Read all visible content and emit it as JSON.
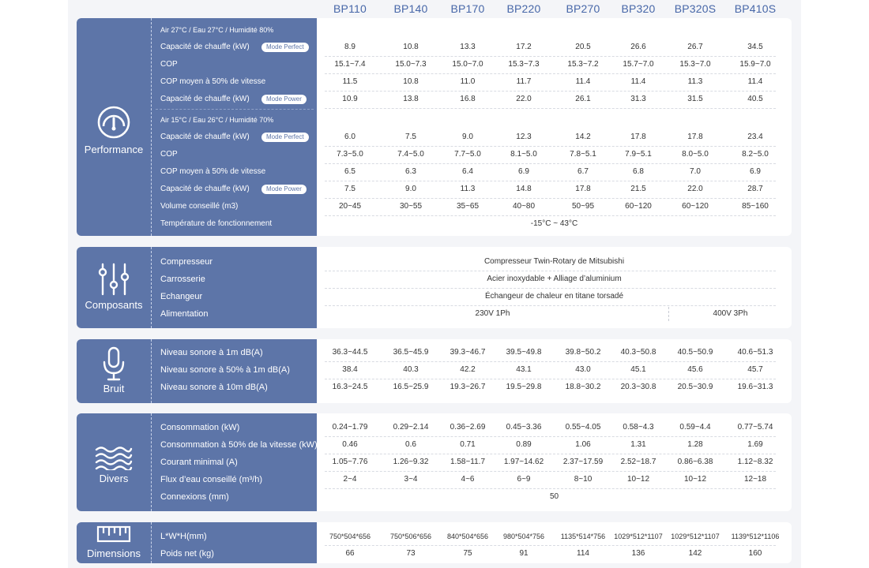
{
  "models": [
    "BP110",
    "BP140",
    "BP170",
    "BP220",
    "BP270",
    "BP320",
    "BP320S",
    "BP410S"
  ],
  "colors": {
    "sidebar": "#5d75a8",
    "header": "#4767a8",
    "text": "#333333"
  },
  "performance": {
    "title": "Performance",
    "icon": "gauge-icon",
    "cond1": "Air 27°C / Eau 27°C / Humidité 80%",
    "cond2": "Air 15°C / Eau 26°C / Humidité 70%",
    "badge_perfect": "Mode Perfect",
    "badge_power": "Mode Power",
    "rows1": [
      {
        "label": "Capacité de chauffe (kW)",
        "badge": "perfect",
        "values": [
          "8.9",
          "10.8",
          "13.3",
          "17.2",
          "20.5",
          "26.6",
          "26.7",
          "34.5"
        ]
      },
      {
        "label": "COP",
        "values": [
          "15.1~7.4",
          "15.0~7.3",
          "15.0~7.0",
          "15.3~7.3",
          "15.3~7.2",
          "15.7~7.0",
          "15.3~7.0",
          "15.9~7.0"
        ]
      },
      {
        "label": "COP moyen à 50% de vitesse",
        "values": [
          "11.5",
          "10.8",
          "11.0",
          "11.7",
          "11.4",
          "11.4",
          "11.3",
          "11.4"
        ]
      },
      {
        "label": "Capacité de chauffe  (kW)",
        "badge": "power",
        "values": [
          "10.9",
          "13.8",
          "16.8",
          "22.0",
          "26.1",
          "31.3",
          "31.5",
          "40.5"
        ]
      }
    ],
    "rows2": [
      {
        "label": "Capacité de chauffe (kW)",
        "badge": "perfect",
        "values": [
          "6.0",
          "7.5",
          "9.0",
          "12.3",
          "14.2",
          "17.8",
          "17.8",
          "23.4"
        ]
      },
      {
        "label": "COP",
        "values": [
          "7.3~5.0",
          "7.4~5.0",
          "7.7~5.0",
          "8.1~5.0",
          "7.8~5.1",
          "7.9~5.1",
          "8.0~5.0",
          "8.2~5.0"
        ]
      },
      {
        "label": "COP moyen à 50% de vitesse",
        "values": [
          "6.5",
          "6.3",
          "6.4",
          "6.9",
          "6.7",
          "6.8",
          "7.0",
          "6.9"
        ]
      },
      {
        "label": "Capacité de chauffe  (kW)",
        "badge": "power",
        "values": [
          "7.5",
          "9.0",
          "11.3",
          "14.8",
          "17.8",
          "21.5",
          "22.0",
          "28.7"
        ]
      },
      {
        "label": "Volume conseillé (m3)",
        "values": [
          "20~45",
          "30~55",
          "35~65",
          "40~80",
          "50~95",
          "60~120",
          "60~120",
          "85~160"
        ]
      }
    ],
    "temp_label": "Température de fonctionnement",
    "temp_value": "-15°C ~ 43°C"
  },
  "composants": {
    "title": "Composants",
    "icon": "sliders-icon",
    "rows": [
      {
        "label": "Compresseur",
        "value": "Compresseur Twin-Rotary de Mitsubishi"
      },
      {
        "label": "Carrosserie",
        "value": "Acier inoxydable + Alliage d’aluminium"
      },
      {
        "label": "Echangeur",
        "value": "Échangeur de chaleur en titane torsadé"
      }
    ],
    "alim_label": "Alimentation",
    "alim_1ph": "230V 1Ph",
    "alim_3ph": "400V 3Ph"
  },
  "bruit": {
    "title": "Bruit",
    "icon": "microphone-icon",
    "rows": [
      {
        "label": "Niveau sonore à 1m dB(A)",
        "values": [
          "36.3~44.5",
          "36.5~45.9",
          "39.3~46.7",
          "39.5~49.8",
          "39.8~50.2",
          "40.3~50.8",
          "40.5~50.9",
          "40.6~51.3"
        ]
      },
      {
        "label": "Niveau sonore à 50% à 1m dB(A)",
        "values": [
          "38.4",
          "40.3",
          "42.2",
          "43.1",
          "43.0",
          "45.1",
          "45.6",
          "45.7"
        ]
      },
      {
        "label": "Niveau sonore à 10m dB(A)",
        "values": [
          "16.3~24.5",
          "16.5~25.9",
          "19.3~26.7",
          "19.5~29.8",
          "18.8~30.2",
          "20.3~30.8",
          "20.5~30.9",
          "19.6~31.3"
        ]
      }
    ]
  },
  "divers": {
    "title": "Divers",
    "icon": "waves-icon",
    "rows": [
      {
        "label": "Consommation (kW)",
        "values": [
          "0.24~1.79",
          "0.29~2.14",
          "0.36~2.69",
          "0.45~3.36",
          "0.55~4.05",
          "0.58~4.3",
          "0.59~4.4",
          "0.77~5.74"
        ]
      },
      {
        "label": "Consommation à 50% de la vitesse (kW)",
        "values": [
          "0.46",
          "0.6",
          "0.71",
          "0.89",
          "1.06",
          "1.31",
          "1.28",
          "1.69"
        ]
      },
      {
        "label": "Courant minimal (A)",
        "values": [
          "1.05~7.76",
          "1.26~9.32",
          "1.58~11.7",
          "1.97~14.62",
          "2.37~17.59",
          "2.52~18.7",
          "0.86~6.38",
          "1.12~8.32"
        ]
      },
      {
        "label": "Flux d’eau conseillé (m³/h)",
        "values": [
          "2~4",
          "3~4",
          "4~6",
          "6~9",
          "8~10",
          "10~12",
          "10~12",
          "12~18"
        ]
      }
    ],
    "connexions_label": "Connexions (mm)",
    "connexions_value": "50"
  },
  "dimensions": {
    "title": "Dimensions",
    "icon": "ruler-icon",
    "rows": [
      {
        "label": "L*W*H(mm)",
        "values": [
          "750*504*656",
          "750*506*656",
          "840*504*656",
          "980*504*756",
          "1135*514*756",
          "1029*512*1107",
          "1029*512*1107",
          "1139*512*1106"
        ]
      },
      {
        "label": "Poids net (kg)",
        "values": [
          "66",
          "73",
          "75",
          "91",
          "114",
          "136",
          "142",
          "160"
        ]
      }
    ]
  }
}
